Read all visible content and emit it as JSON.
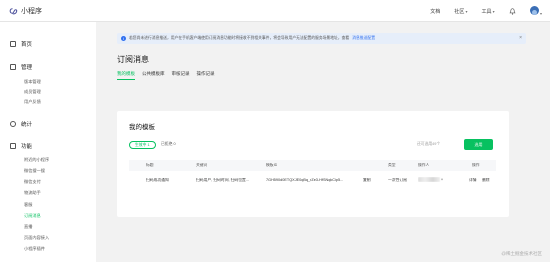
{
  "app": {
    "name": "小程序"
  },
  "topnav": {
    "docs": "文档",
    "community": "社区",
    "tools": "工具"
  },
  "sidebar": {
    "groups": [
      {
        "label": "首页"
      },
      {
        "label": "管理"
      },
      {
        "label": "统计"
      },
      {
        "label": "功能"
      }
    ],
    "manage_items": [
      "版本管理",
      "成员管理",
      "用户反馈"
    ],
    "feature_items": [
      "附近的小程序",
      "微信搜一搜",
      "微信支付",
      "物流助手",
      "客服",
      "订阅消息",
      "直播",
      "页面内容接入",
      "小程序插件"
    ]
  },
  "notice": {
    "text": "若您尚未进行消息推送，用户在手机客户端使用订阅消息功能时将接收不到相关事件，将会导致用户无法配置的服务场景地址，查看",
    "link": "消息推送配置"
  },
  "page": {
    "title": "订阅消息",
    "tabs": [
      "我的模板",
      "公共模板库",
      "审核记录",
      "操作记录"
    ]
  },
  "card": {
    "title": "我的模板",
    "pill_label": "生效中 1",
    "pill2_label": "已拒绝 0",
    "remaining": "还可选用49个",
    "choose_btn": "选用",
    "columns": [
      "标题",
      "关键词",
      "模板ID",
      "类型",
      "操作人",
      "操作"
    ],
    "rows": [
      {
        "title": "扫码成功通知",
        "keywords": "扫码用户, 扫码时间, 扫码位置...",
        "template_id": "7GH590d0ETQXJE0qBq_rZe3-HfSNqkCip5...",
        "copy": "复制",
        "type": "一次性订阅",
        "detail": "详情",
        "delete": "删除"
      }
    ]
  },
  "watermark": "@稀土掘金技术社区"
}
